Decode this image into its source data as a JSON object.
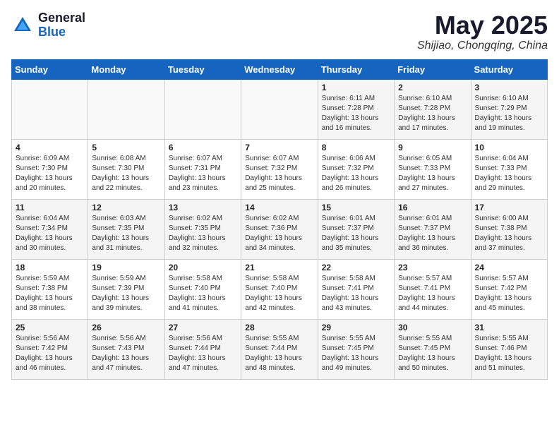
{
  "header": {
    "logo_general": "General",
    "logo_blue": "Blue",
    "month": "May 2025",
    "location": "Shijiao, Chongqing, China"
  },
  "weekdays": [
    "Sunday",
    "Monday",
    "Tuesday",
    "Wednesday",
    "Thursday",
    "Friday",
    "Saturday"
  ],
  "weeks": [
    [
      {
        "day": "",
        "sunrise": "",
        "sunset": "",
        "daylight": ""
      },
      {
        "day": "",
        "sunrise": "",
        "sunset": "",
        "daylight": ""
      },
      {
        "day": "",
        "sunrise": "",
        "sunset": "",
        "daylight": ""
      },
      {
        "day": "",
        "sunrise": "",
        "sunset": "",
        "daylight": ""
      },
      {
        "day": "1",
        "sunrise": "Sunrise: 6:11 AM",
        "sunset": "Sunset: 7:28 PM",
        "daylight": "Daylight: 13 hours and 16 minutes."
      },
      {
        "day": "2",
        "sunrise": "Sunrise: 6:10 AM",
        "sunset": "Sunset: 7:28 PM",
        "daylight": "Daylight: 13 hours and 17 minutes."
      },
      {
        "day": "3",
        "sunrise": "Sunrise: 6:10 AM",
        "sunset": "Sunset: 7:29 PM",
        "daylight": "Daylight: 13 hours and 19 minutes."
      }
    ],
    [
      {
        "day": "4",
        "sunrise": "Sunrise: 6:09 AM",
        "sunset": "Sunset: 7:30 PM",
        "daylight": "Daylight: 13 hours and 20 minutes."
      },
      {
        "day": "5",
        "sunrise": "Sunrise: 6:08 AM",
        "sunset": "Sunset: 7:30 PM",
        "daylight": "Daylight: 13 hours and 22 minutes."
      },
      {
        "day": "6",
        "sunrise": "Sunrise: 6:07 AM",
        "sunset": "Sunset: 7:31 PM",
        "daylight": "Daylight: 13 hours and 23 minutes."
      },
      {
        "day": "7",
        "sunrise": "Sunrise: 6:07 AM",
        "sunset": "Sunset: 7:32 PM",
        "daylight": "Daylight: 13 hours and 25 minutes."
      },
      {
        "day": "8",
        "sunrise": "Sunrise: 6:06 AM",
        "sunset": "Sunset: 7:32 PM",
        "daylight": "Daylight: 13 hours and 26 minutes."
      },
      {
        "day": "9",
        "sunrise": "Sunrise: 6:05 AM",
        "sunset": "Sunset: 7:33 PM",
        "daylight": "Daylight: 13 hours and 27 minutes."
      },
      {
        "day": "10",
        "sunrise": "Sunrise: 6:04 AM",
        "sunset": "Sunset: 7:33 PM",
        "daylight": "Daylight: 13 hours and 29 minutes."
      }
    ],
    [
      {
        "day": "11",
        "sunrise": "Sunrise: 6:04 AM",
        "sunset": "Sunset: 7:34 PM",
        "daylight": "Daylight: 13 hours and 30 minutes."
      },
      {
        "day": "12",
        "sunrise": "Sunrise: 6:03 AM",
        "sunset": "Sunset: 7:35 PM",
        "daylight": "Daylight: 13 hours and 31 minutes."
      },
      {
        "day": "13",
        "sunrise": "Sunrise: 6:02 AM",
        "sunset": "Sunset: 7:35 PM",
        "daylight": "Daylight: 13 hours and 32 minutes."
      },
      {
        "day": "14",
        "sunrise": "Sunrise: 6:02 AM",
        "sunset": "Sunset: 7:36 PM",
        "daylight": "Daylight: 13 hours and 34 minutes."
      },
      {
        "day": "15",
        "sunrise": "Sunrise: 6:01 AM",
        "sunset": "Sunset: 7:37 PM",
        "daylight": "Daylight: 13 hours and 35 minutes."
      },
      {
        "day": "16",
        "sunrise": "Sunrise: 6:01 AM",
        "sunset": "Sunset: 7:37 PM",
        "daylight": "Daylight: 13 hours and 36 minutes."
      },
      {
        "day": "17",
        "sunrise": "Sunrise: 6:00 AM",
        "sunset": "Sunset: 7:38 PM",
        "daylight": "Daylight: 13 hours and 37 minutes."
      }
    ],
    [
      {
        "day": "18",
        "sunrise": "Sunrise: 5:59 AM",
        "sunset": "Sunset: 7:38 PM",
        "daylight": "Daylight: 13 hours and 38 minutes."
      },
      {
        "day": "19",
        "sunrise": "Sunrise: 5:59 AM",
        "sunset": "Sunset: 7:39 PM",
        "daylight": "Daylight: 13 hours and 39 minutes."
      },
      {
        "day": "20",
        "sunrise": "Sunrise: 5:58 AM",
        "sunset": "Sunset: 7:40 PM",
        "daylight": "Daylight: 13 hours and 41 minutes."
      },
      {
        "day": "21",
        "sunrise": "Sunrise: 5:58 AM",
        "sunset": "Sunset: 7:40 PM",
        "daylight": "Daylight: 13 hours and 42 minutes."
      },
      {
        "day": "22",
        "sunrise": "Sunrise: 5:58 AM",
        "sunset": "Sunset: 7:41 PM",
        "daylight": "Daylight: 13 hours and 43 minutes."
      },
      {
        "day": "23",
        "sunrise": "Sunrise: 5:57 AM",
        "sunset": "Sunset: 7:41 PM",
        "daylight": "Daylight: 13 hours and 44 minutes."
      },
      {
        "day": "24",
        "sunrise": "Sunrise: 5:57 AM",
        "sunset": "Sunset: 7:42 PM",
        "daylight": "Daylight: 13 hours and 45 minutes."
      }
    ],
    [
      {
        "day": "25",
        "sunrise": "Sunrise: 5:56 AM",
        "sunset": "Sunset: 7:42 PM",
        "daylight": "Daylight: 13 hours and 46 minutes."
      },
      {
        "day": "26",
        "sunrise": "Sunrise: 5:56 AM",
        "sunset": "Sunset: 7:43 PM",
        "daylight": "Daylight: 13 hours and 47 minutes."
      },
      {
        "day": "27",
        "sunrise": "Sunrise: 5:56 AM",
        "sunset": "Sunset: 7:44 PM",
        "daylight": "Daylight: 13 hours and 47 minutes."
      },
      {
        "day": "28",
        "sunrise": "Sunrise: 5:55 AM",
        "sunset": "Sunset: 7:44 PM",
        "daylight": "Daylight: 13 hours and 48 minutes."
      },
      {
        "day": "29",
        "sunrise": "Sunrise: 5:55 AM",
        "sunset": "Sunset: 7:45 PM",
        "daylight": "Daylight: 13 hours and 49 minutes."
      },
      {
        "day": "30",
        "sunrise": "Sunrise: 5:55 AM",
        "sunset": "Sunset: 7:45 PM",
        "daylight": "Daylight: 13 hours and 50 minutes."
      },
      {
        "day": "31",
        "sunrise": "Sunrise: 5:55 AM",
        "sunset": "Sunset: 7:46 PM",
        "daylight": "Daylight: 13 hours and 51 minutes."
      }
    ]
  ]
}
